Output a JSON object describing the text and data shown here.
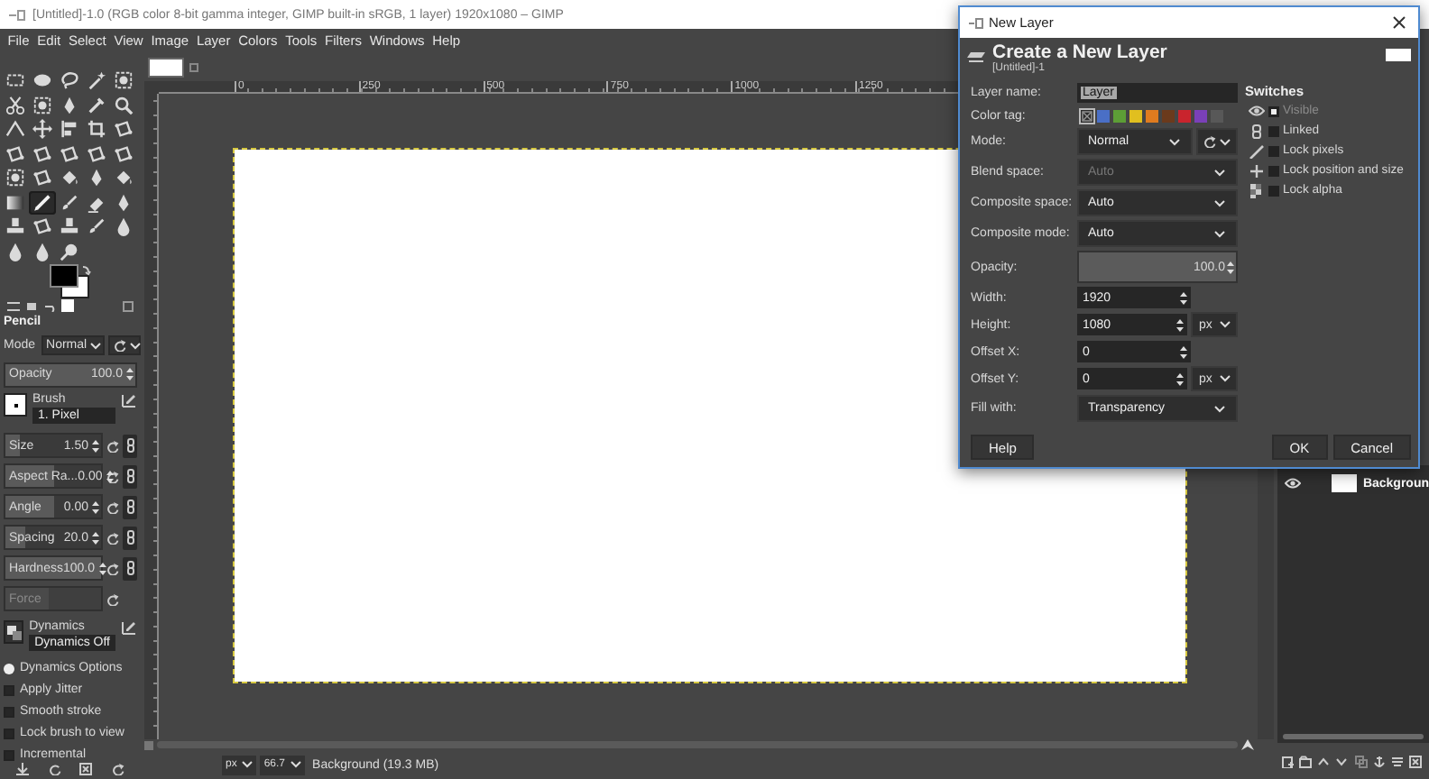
{
  "window": {
    "title": "[Untitled]-1.0 (RGB color 8-bit gamma integer, GIMP built-in sRGB, 1 layer) 1920x1080 – GIMP"
  },
  "menu": [
    "File",
    "Edit",
    "Select",
    "View",
    "Image",
    "Layer",
    "Colors",
    "Tools",
    "Filters",
    "Windows",
    "Help"
  ],
  "toolbox": {
    "tools": [
      {
        "selected": false
      },
      {
        "selected": false
      },
      {
        "selected": false
      },
      {
        "selected": false
      },
      {
        "selected": false
      },
      {
        "selected": false
      },
      {
        "selected": false
      },
      {
        "selected": false
      },
      {
        "selected": false
      },
      {
        "selected": false
      },
      {
        "selected": false
      },
      {
        "selected": false
      },
      {
        "selected": false
      },
      {
        "selected": false
      },
      {
        "selected": false
      },
      {
        "selected": false
      },
      {
        "selected": false
      },
      {
        "selected": false
      },
      {
        "selected": false
      },
      {
        "selected": false
      },
      {
        "selected": false
      },
      {
        "selected": false
      },
      {
        "selected": false
      },
      {
        "selected": false
      },
      {
        "selected": false
      },
      {
        "selected": false
      },
      {
        "selected": true
      },
      {
        "selected": false
      },
      {
        "selected": false
      },
      {
        "selected": false
      },
      {
        "selected": false
      },
      {
        "selected": false
      },
      {
        "selected": false
      },
      {
        "selected": false
      },
      {
        "selected": false
      },
      {
        "selected": false
      },
      {
        "selected": false
      },
      {
        "selected": false
      }
    ]
  },
  "tool_options": {
    "title": "Pencil",
    "mode": {
      "label": "Mode",
      "value": "Normal"
    },
    "opacity": {
      "label": "Opacity",
      "value": "100.0",
      "level": 1
    },
    "brush": {
      "label": "Brush",
      "value": "1. Pixel"
    },
    "sliders": [
      {
        "label": "Size",
        "value": "1.50",
        "level": 0.15,
        "disabled": false
      },
      {
        "label": "Aspect Ra...",
        "value": "0.00",
        "level": 0.5,
        "disabled": false
      },
      {
        "label": "Angle",
        "value": "0.00",
        "level": 0.5,
        "disabled": false
      },
      {
        "label": "Spacing",
        "value": "20.0",
        "level": 0.2,
        "disabled": false
      },
      {
        "label": "Hardness",
        "value": "100.0",
        "level": 1,
        "disabled": false
      },
      {
        "label": "Force",
        "level": 0.45,
        "disabled": true
      }
    ],
    "dynamics": {
      "label": "Dynamics",
      "value": "Dynamics Off"
    },
    "dynamics_options": {
      "label": "Dynamics Options"
    },
    "options": [
      {
        "label": "Apply Jitter",
        "checked": false
      },
      {
        "label": "Smooth stroke",
        "checked": false
      },
      {
        "label": "Lock brush to view",
        "checked": false
      },
      {
        "label": "Incremental",
        "checked": false
      }
    ]
  },
  "canvas": {
    "ruler_labels": [
      "0",
      "250",
      "500",
      "750",
      "1000",
      "1250"
    ]
  },
  "status_bar": {
    "unit": "px",
    "zoom": "66.7",
    "info": "Background (19.3 MB)"
  },
  "layers": [
    {
      "name": "Backgroun",
      "visible": true
    }
  ],
  "dialog": {
    "title": "New Layer",
    "heading": "Create a New Layer",
    "subtitle": "[Untitled]-1",
    "fields": [
      {
        "kind": "text",
        "label": "Layer name:",
        "value": "Layer",
        "selected": true
      },
      {
        "kind": "tags",
        "label": "Color tag:",
        "tags": [
          {
            "kind": "none",
            "selected": true
          },
          {
            "kind": "color",
            "color": "#4a6fc6",
            "selected": false
          },
          {
            "kind": "color",
            "color": "#5d9e36",
            "selected": false
          },
          {
            "kind": "color",
            "color": "#e1bf1f",
            "selected": false
          },
          {
            "kind": "color",
            "color": "#e07b1f",
            "selected": false
          },
          {
            "kind": "color",
            "color": "#6b3a1c",
            "selected": false
          },
          {
            "kind": "color",
            "color": "#c9242d",
            "selected": false
          },
          {
            "kind": "color",
            "color": "#7a40b8",
            "selected": false
          },
          {
            "kind": "color",
            "color": "#585858",
            "selected": false
          }
        ]
      },
      {
        "kind": "mode",
        "label": "Mode:",
        "value": "Normal"
      },
      {
        "kind": "select",
        "label": "Blend space:",
        "value": "Auto",
        "disabled": true
      },
      {
        "kind": "select",
        "label": "Composite space:",
        "value": "Auto",
        "disabled": false
      },
      {
        "kind": "select",
        "label": "Composite mode:",
        "value": "Auto",
        "disabled": false
      },
      {
        "kind": "slider",
        "label": "Opacity:",
        "value": "100.0",
        "level": 1
      },
      {
        "kind": "spin",
        "label": "Width:",
        "value": "1920"
      },
      {
        "kind": "spin",
        "label": "Height:",
        "value": "1080",
        "unit": "px"
      },
      {
        "kind": "spin",
        "label": "Offset X:",
        "value": "0"
      },
      {
        "kind": "spin",
        "label": "Offset Y:",
        "value": "0",
        "unit": "px"
      },
      {
        "kind": "select",
        "label": "Fill with:",
        "value": "Transparency",
        "disabled": false
      }
    ],
    "switches": {
      "title": "Switches",
      "items": [
        {
          "label": "Visible",
          "checked": true,
          "disabled": true
        },
        {
          "label": "Linked",
          "checked": false,
          "disabled": false
        },
        {
          "label": "Lock pixels",
          "checked": false,
          "disabled": false
        },
        {
          "label": "Lock position and size",
          "checked": false,
          "disabled": false
        },
        {
          "label": "Lock alpha",
          "checked": false,
          "disabled": false
        }
      ]
    },
    "buttons": [
      "Help",
      "OK",
      "Cancel"
    ]
  }
}
